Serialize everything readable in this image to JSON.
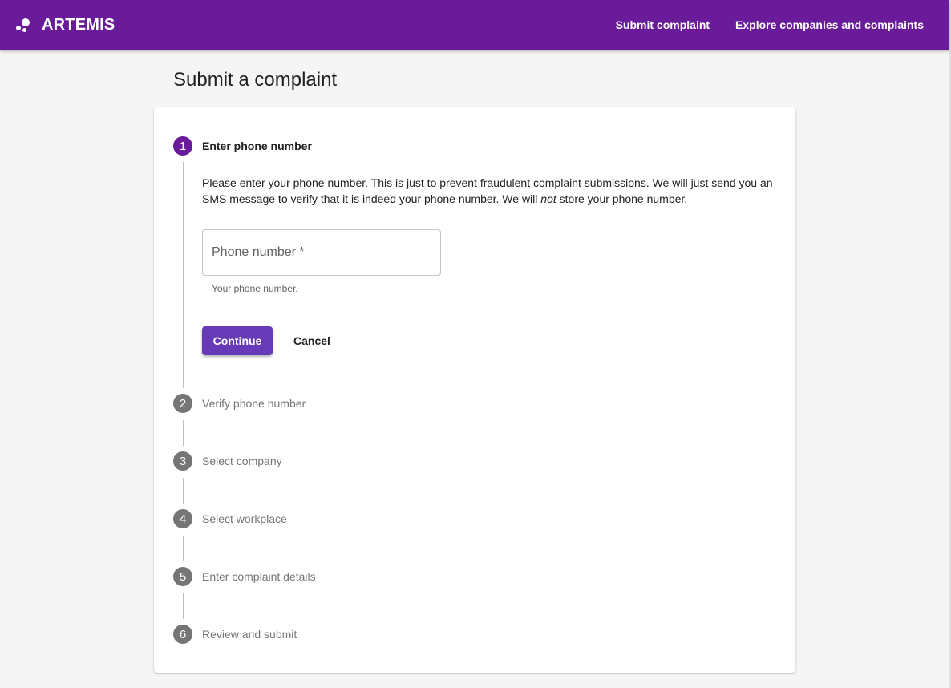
{
  "header": {
    "brand": "ARTEMIS",
    "nav": [
      {
        "label": "Submit complaint"
      },
      {
        "label": "Explore companies and complaints"
      }
    ],
    "background_color": "#6a1b9a"
  },
  "page": {
    "title": "Submit a complaint"
  },
  "stepper": {
    "steps": [
      {
        "number": "1",
        "label": "Enter phone number",
        "state": "active"
      },
      {
        "number": "2",
        "label": "Verify phone number",
        "state": "inactive"
      },
      {
        "number": "3",
        "label": "Select company",
        "state": "inactive"
      },
      {
        "number": "4",
        "label": "Select workplace",
        "state": "inactive"
      },
      {
        "number": "5",
        "label": "Enter complaint details",
        "state": "inactive"
      },
      {
        "number": "6",
        "label": "Review and submit",
        "state": "inactive"
      }
    ],
    "active_color": "#6a1b9a",
    "inactive_color": "#757575"
  },
  "step1": {
    "description_before": "Please enter your phone number. This is just to prevent fraudulent complaint submissions. We will just send you an SMS message to verify that it is indeed your phone number. We will ",
    "description_emphasis": "not",
    "description_after": " store your phone number.",
    "phone_field": {
      "placeholder": "Phone number *",
      "value": "",
      "helper": "Your phone number."
    },
    "continue_label": "Continue",
    "cancel_label": "Cancel",
    "continue_color": "#673ab7"
  }
}
